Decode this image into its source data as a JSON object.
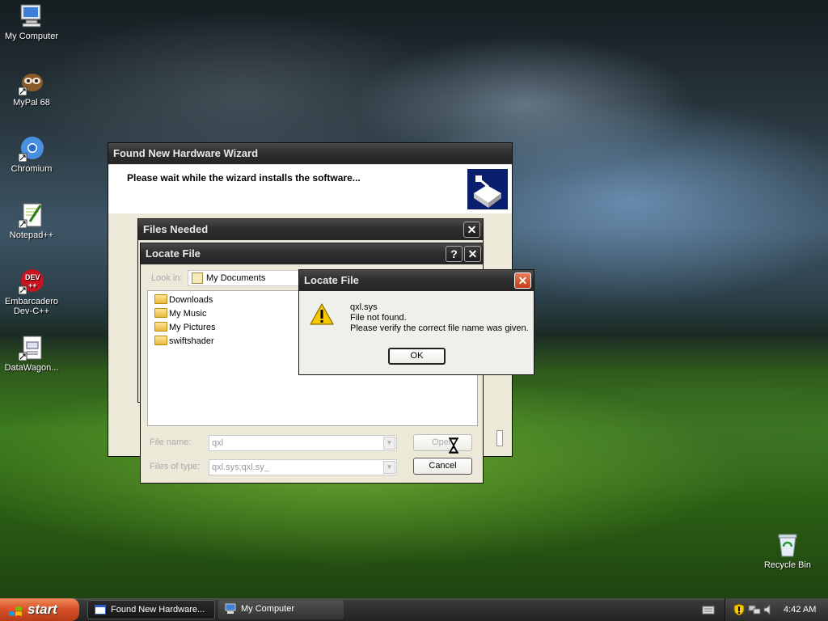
{
  "desktop": {
    "icons": [
      {
        "label": "My Computer"
      },
      {
        "label": "MyPal 68"
      },
      {
        "label": "Chromium"
      },
      {
        "label": "Notepad++"
      },
      {
        "label": "Embarcadero Dev-C++"
      },
      {
        "label": "DataWagon..."
      },
      {
        "label": "Recycle Bin"
      }
    ]
  },
  "wizard": {
    "title": "Found New Hardware Wizard",
    "heading": "Please wait while the wizard installs the software..."
  },
  "files_needed": {
    "title": "Files Needed",
    "close": "✕"
  },
  "locate_file": {
    "title": "Locate File",
    "help": "?",
    "close": "✕",
    "look_in_label": "Look in:",
    "look_in_value": "My Documents",
    "files": [
      "Downloads",
      "My Music",
      "My Pictures",
      "swiftshader"
    ],
    "file_name_label": "File name:",
    "file_name_value": "qxl",
    "files_of_type_label": "Files of type:",
    "files_of_type_value": "qxl.sys;qxl.sy_",
    "open_label": "Open",
    "cancel_label": "Cancel"
  },
  "error_dialog": {
    "title": "Locate File",
    "close": "✕",
    "line1": "qxl.sys",
    "line2": "File not found.",
    "line3": "Please verify the correct file name was given.",
    "ok_label": "OK"
  },
  "taskbar": {
    "start_label": "start",
    "tasks": [
      {
        "label": "Found New Hardware..."
      },
      {
        "label": "My Computer"
      }
    ],
    "clock": "4:42 AM"
  },
  "colors": {
    "start": "#d9532a",
    "titlebar": "#2e2e2e",
    "error_close": "#d8502c",
    "warning": "#f6c800"
  }
}
